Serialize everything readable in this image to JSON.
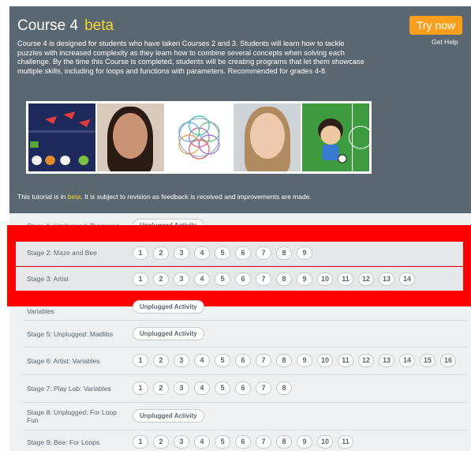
{
  "header": {
    "title": "Course 4",
    "beta_label": "beta",
    "try_button": "Try now",
    "get_help": "Get Help",
    "description": "Course 4 is designed for students who have taken Courses 2 and 3. Students will learn how to tackle puzzles with increased complexity as they learn how to combine several concepts when solving each challenge. By the time this Course is completed, students will be creating programs that let them showcase multiple skills, including for loops and functions with parameters. Recommended for grades 4-8.",
    "disclaimer_pre": "This tutorial is in",
    "disclaimer_beta": "beta",
    "disclaimer_post": ". It is subject to revision as feedback is received and improvements are made."
  },
  "stages": [
    {
      "name": "Stage 1: Unplugged: Tangrams",
      "unplugged": "Unplugged Activity"
    },
    {
      "name": "Stage 2: Maze and Bee",
      "levels": [
        "1",
        "2",
        "3",
        "4",
        "5",
        "6",
        "7",
        "8",
        "9"
      ]
    },
    {
      "name": "Stage 3: Artist",
      "levels": [
        "1",
        "2",
        "3",
        "4",
        "5",
        "6",
        "7",
        "8",
        "9",
        "10",
        "11",
        "12",
        "13",
        "14"
      ]
    },
    {
      "name": "Variables",
      "unplugged": "Unplugged Activity"
    },
    {
      "name": "Stage 5: Unplugged: Madlibs",
      "unplugged": "Unplugged Activity"
    },
    {
      "name": "Stage 6: Artist: Variables",
      "levels": [
        "1",
        "2",
        "3",
        "4",
        "5",
        "6",
        "7",
        "8",
        "9",
        "10",
        "11",
        "12",
        "13",
        "14",
        "15",
        "16"
      ]
    },
    {
      "name": "Stage 7: Play Lab: Variables",
      "levels": [
        "1",
        "2",
        "3",
        "4",
        "5",
        "6",
        "7",
        "8"
      ]
    },
    {
      "name": "Stage 8: Unplugged: For Loop Fun",
      "unplugged": "Unplugged Activity"
    },
    {
      "name": "Stage 9: Bee: For Loops",
      "levels": [
        "1",
        "2",
        "3",
        "4",
        "5",
        "6",
        "7",
        "8",
        "9",
        "10",
        "11"
      ]
    }
  ],
  "colors": {
    "header_bg": "#5b6770",
    "accent_yellow": "#f5d632",
    "button_orange": "#f8a01e",
    "highlight_red": "#ff0000"
  }
}
